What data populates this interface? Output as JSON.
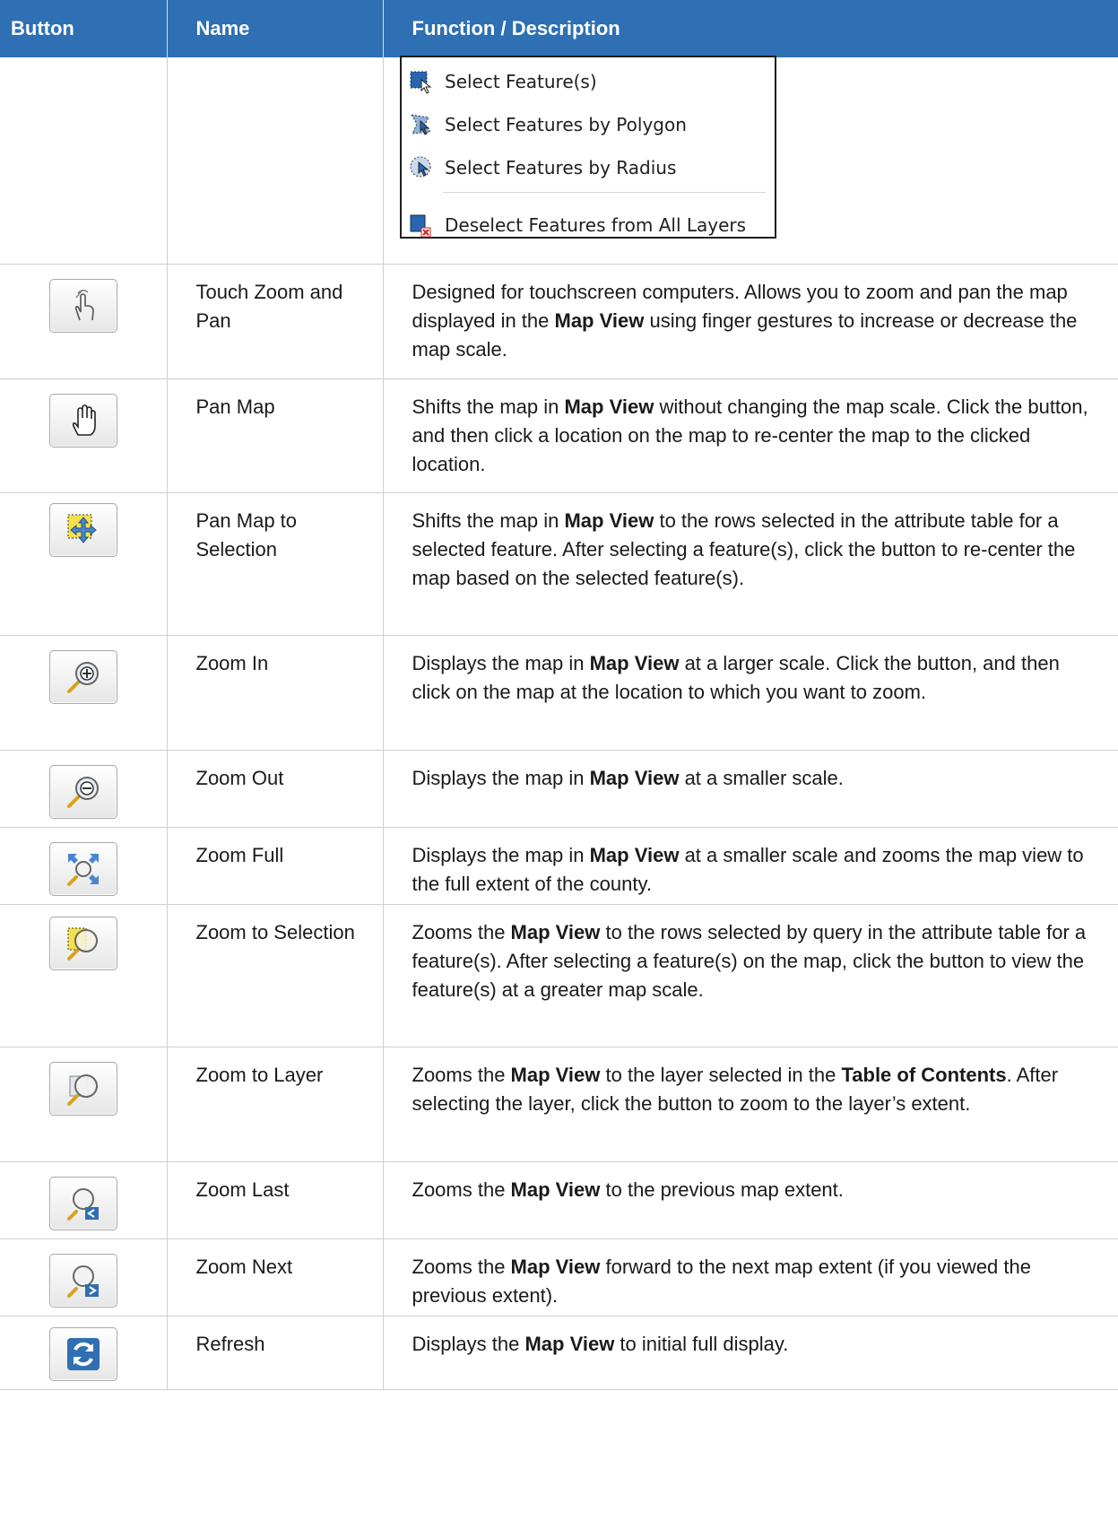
{
  "header": {
    "col_button": "Button",
    "col_name": "Name",
    "col_description": "Function / Description"
  },
  "select_menu": {
    "items": [
      {
        "label": "Select Feature(s)",
        "icon": "select-feature-icon"
      },
      {
        "label": "Select Features by Polygon",
        "icon": "select-polygon-icon"
      },
      {
        "label": "Select Features by Radius",
        "icon": "select-radius-icon"
      },
      {
        "label": "Deselect Features from All Layers",
        "icon": "deselect-all-icon"
      }
    ]
  },
  "rows": [
    {
      "name": "Touch Zoom and Pan",
      "icon": "touch-gesture-icon",
      "desc": [
        {
          "t": "Designed for touchscreen computers. Allows you to zoom and pan the map displayed in the "
        },
        {
          "b": "Map View"
        },
        {
          "t": " using finger gestures to increase or decrease the map scale."
        }
      ]
    },
    {
      "name": "Pan Map",
      "icon": "pan-hand-icon",
      "desc": [
        {
          "t": "Shifts the map in "
        },
        {
          "b": "Map View"
        },
        {
          "t": " without changing the map scale. Click the button, and then click a location on the map to re-center the map to the clicked location."
        }
      ]
    },
    {
      "name": "Pan Map to Selection",
      "icon": "pan-to-selection-icon",
      "desc": [
        {
          "t": "Shifts the map in "
        },
        {
          "b": "Map View"
        },
        {
          "t": " to the rows selected in the attribute table for a selected feature. After selecting a feature(s), click the button to re-center the map based on the selected feature(s)."
        }
      ]
    },
    {
      "name": "Zoom In",
      "icon": "zoom-in-icon",
      "desc": [
        {
          "t": "Displays the map in "
        },
        {
          "b": "Map View"
        },
        {
          "t": " at a larger scale. Click the button, and then click on the map at the location to which you want to zoom."
        }
      ]
    },
    {
      "name": "Zoom Out",
      "icon": "zoom-out-icon",
      "desc": [
        {
          "t": "Displays the map in "
        },
        {
          "b": "Map View"
        },
        {
          "t": " at a smaller scale."
        }
      ]
    },
    {
      "name": "Zoom Full",
      "icon": "zoom-full-icon",
      "desc": [
        {
          "t": "Displays the map in "
        },
        {
          "b": "Map View"
        },
        {
          "t": " at a smaller scale and zooms the map view to the full extent of the county."
        }
      ]
    },
    {
      "name": "Zoom to Selection",
      "icon": "zoom-to-selection-icon",
      "desc": [
        {
          "t": "Zooms the "
        },
        {
          "b": "Map View"
        },
        {
          "t": " to the rows selected by query in the attribute table for a feature(s). After selecting a feature(s) on the map, click the button to view the feature(s) at a greater map scale."
        }
      ]
    },
    {
      "name": "Zoom to Layer",
      "icon": "zoom-to-layer-icon",
      "desc": [
        {
          "t": "Zooms the "
        },
        {
          "b": "Map View"
        },
        {
          "t": " to the layer selected in the "
        },
        {
          "b": "Table of Contents"
        },
        {
          "t": ". After selecting the layer, click the button to zoom to the layer’s extent."
        }
      ]
    },
    {
      "name": "Zoom Last",
      "icon": "zoom-last-icon",
      "desc": [
        {
          "t": "Zooms the "
        },
        {
          "b": "Map View"
        },
        {
          "t": " to the previous map extent."
        }
      ]
    },
    {
      "name": "Zoom Next",
      "icon": "zoom-next-icon",
      "desc": [
        {
          "t": "Zooms the "
        },
        {
          "b": "Map View"
        },
        {
          "t": " forward to the next map extent (if you viewed the previous extent)."
        }
      ]
    },
    {
      "name": "Refresh",
      "icon": "refresh-icon",
      "desc": [
        {
          "t": "Displays the "
        },
        {
          "b": "Map View"
        },
        {
          "t": " to initial full display."
        }
      ]
    }
  ],
  "colors": {
    "header_bg": "#2f6fb3",
    "header_text": "#ffffff",
    "border": "#cfcfcf"
  }
}
